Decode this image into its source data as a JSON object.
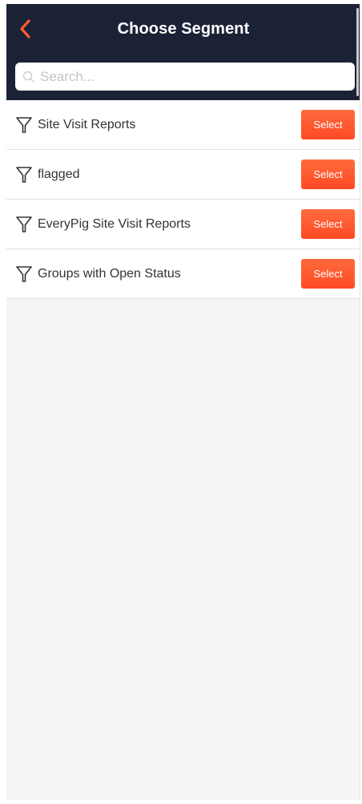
{
  "header": {
    "title": "Choose Segment",
    "back_icon": "chevron-left-icon"
  },
  "search": {
    "placeholder": "Search...",
    "value": "",
    "icon": "search-icon"
  },
  "segments": [
    {
      "label": "Site Visit Reports",
      "button": "Select",
      "icon": "filter-icon"
    },
    {
      "label": "flagged",
      "button": "Select",
      "icon": "filter-icon"
    },
    {
      "label": "EveryPig Site Visit Reports",
      "button": "Select",
      "icon": "filter-icon"
    },
    {
      "label": "Groups with Open Status",
      "button": "Select",
      "icon": "filter-icon"
    }
  ],
  "colors": {
    "header_bg": "#1c2236",
    "accent": "#ff5a30",
    "back_icon": "#ff5a30",
    "panel_bg": "#f5f5f5"
  }
}
